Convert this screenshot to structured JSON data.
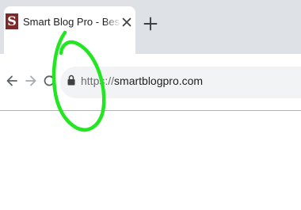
{
  "tab": {
    "favicon_letter": "S",
    "title": "Smart Blog Pro - Best Finance & Business Blog"
  },
  "address_bar": {
    "scheme": "https://",
    "host": "smartblogpro.com"
  },
  "icons": {
    "favicon": "site-favicon",
    "tab_close": "close-icon",
    "new_tab": "plus-icon",
    "back": "back-arrow-icon",
    "forward": "forward-arrow-icon",
    "reload": "reload-icon",
    "lock": "lock-icon"
  },
  "colors": {
    "annotation": "#22e622",
    "tabstrip": "#dee1e6",
    "omnibox": "#f1f3f4",
    "favicon": "#7a2a2a"
  }
}
